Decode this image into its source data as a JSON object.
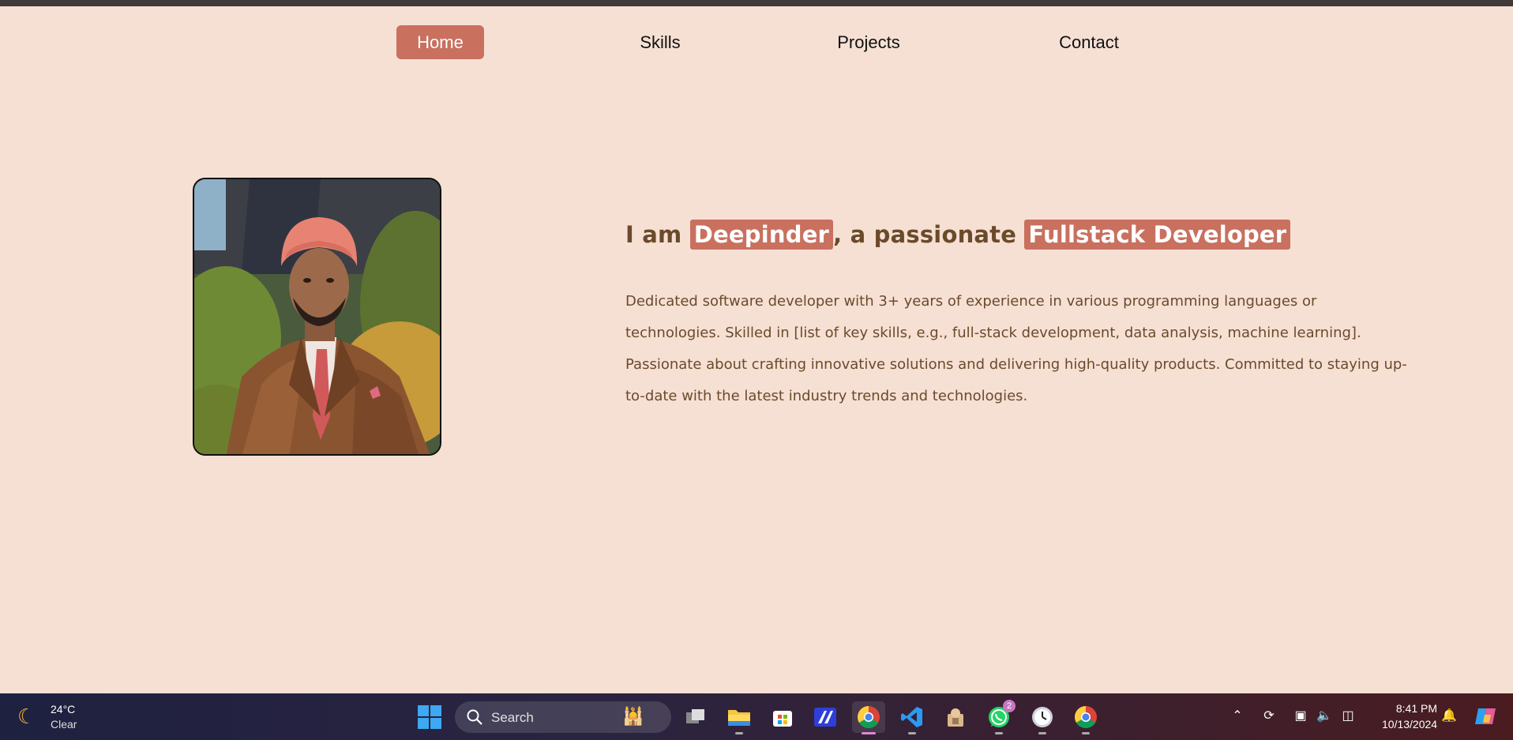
{
  "nav": {
    "items": [
      {
        "label": "Home",
        "active": true
      },
      {
        "label": "Skills",
        "active": false
      },
      {
        "label": "Projects",
        "active": false
      },
      {
        "label": "Contact",
        "active": false
      }
    ]
  },
  "hero": {
    "prefix": "I am ",
    "name": "Deepinder",
    "middle": ", a passionate ",
    "role": "Fullstack Developer",
    "bio": "Dedicated software developer with 3+ years of experience in various programming languages or technologies. Skilled in [list of key skills, e.g., full-stack development, data analysis, machine learning]. Passionate about crafting innovative solutions and delivering high-quality products. Committed to staying up-to-date with the latest industry trends and technologies."
  },
  "colors": {
    "background": "#f6e0d4",
    "accent": "#c9705f",
    "text": "#6b4a2b"
  },
  "taskbar": {
    "weather": {
      "temp": "24°C",
      "condition": "Clear",
      "icon": "moon-icon"
    },
    "search": {
      "label": "Search"
    },
    "apps": [
      {
        "name": "task-view-icon"
      },
      {
        "name": "file-explorer-icon"
      },
      {
        "name": "microsoft-store-icon"
      },
      {
        "name": "editor-app-icon"
      },
      {
        "name": "chrome-icon",
        "active": true
      },
      {
        "name": "vscode-icon"
      },
      {
        "name": "utility-app-icon"
      },
      {
        "name": "whatsapp-icon",
        "badge": "2"
      },
      {
        "name": "clock-app-icon"
      },
      {
        "name": "chrome-profile-icon"
      }
    ],
    "clock": {
      "time": "8:41 PM",
      "date": "10/13/2024"
    }
  }
}
